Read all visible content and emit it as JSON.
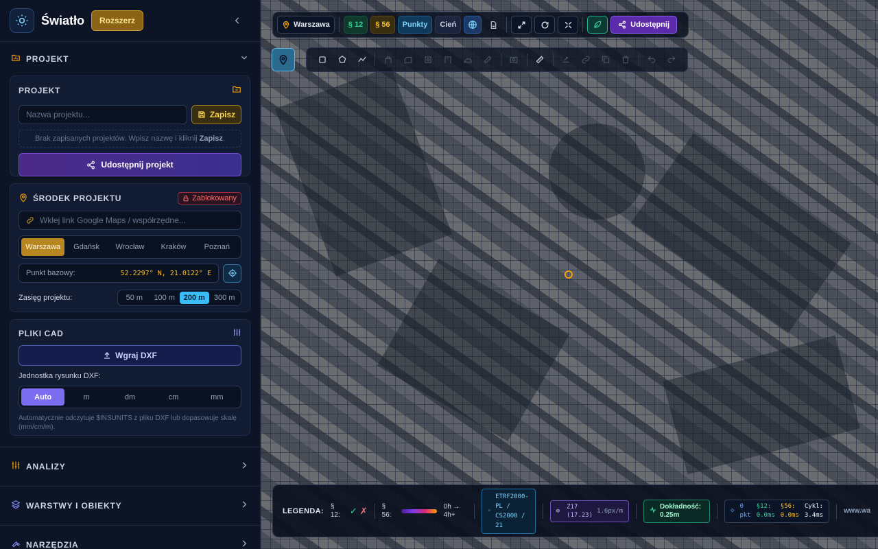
{
  "app": {
    "title": "Światło",
    "expand_label": "Rozszerz"
  },
  "sections": {
    "projekt": "PROJEKT",
    "analizy": "ANALIZY",
    "warstwy": "WARSTWY I OBIEKTY",
    "narzedzia": "NARZĘDZIA"
  },
  "project_card": {
    "title": "PROJEKT",
    "name_placeholder": "Nazwa projektu...",
    "save_label": "Zapisz",
    "empty_prefix": "Brak zapisanych projektów. Wpisz nazwę i kliknij ",
    "empty_bold": "Zapisz",
    "empty_suffix": ".",
    "share_label": "Udostępnij projekt"
  },
  "center_card": {
    "title": "ŚRODEK PROJEKTU",
    "locked_label": "Zablokowany",
    "link_placeholder": "Wklej link Google Maps / współrzędne...",
    "cities": [
      "Warszawa",
      "Gdańsk",
      "Wrocław",
      "Kraków",
      "Poznań"
    ],
    "selected_city": "Warszawa",
    "base_label": "Punkt bazowy:",
    "base_value": "52.2297° N, 21.0122° E",
    "range_label": "Zasięg projektu:",
    "ranges": [
      "50 m",
      "100 m",
      "200 m",
      "300 m"
    ],
    "selected_range": "200 m"
  },
  "cad_card": {
    "title": "PLIKI CAD",
    "upload_label": "Wgraj DXF",
    "unit_label": "Jednostka rysunku DXF:",
    "units": [
      "Auto",
      "m",
      "dm",
      "cm",
      "mm"
    ],
    "selected_unit": "Auto",
    "hint": "Automatycznie odczytuje $INSUNITS z pliku DXF lub dopasowuje skalę (mm/cm/m)."
  },
  "topbar": {
    "location": "Warszawa",
    "s12": "§ 12",
    "s56": "§ 56",
    "points": "Punkty",
    "shadow": "Cień",
    "share": "Udostępnij"
  },
  "legend": {
    "title": "LEGENDA:",
    "s12_label": "§ 12:",
    "ok": "✓",
    "bad": "✗",
    "s56_label": "§ 56:",
    "range_low": "0h →",
    "range_high": "4h+",
    "crs": "ETRF2000-PL / CS2000 / 21",
    "zoom": "Z17 (17.23)",
    "scale": "1.6px/m",
    "accuracy": "Dokładność: 0.25m",
    "pts_count": "0",
    "pts_unit": "pkt",
    "s12_time_label": "§12:",
    "s12_time": "0.0ms",
    "s56_time_label": "§56:",
    "s56_time": "0.0ms",
    "cycle_label": "Cykl:",
    "cycle_time": "3.4ms",
    "url": "www.wa"
  },
  "colors": {
    "accent_gold": "#b7861e",
    "accent_cyan": "#38bdf8",
    "accent_violet": "#7c6cf0",
    "share_purple": "#5b2aa8"
  }
}
